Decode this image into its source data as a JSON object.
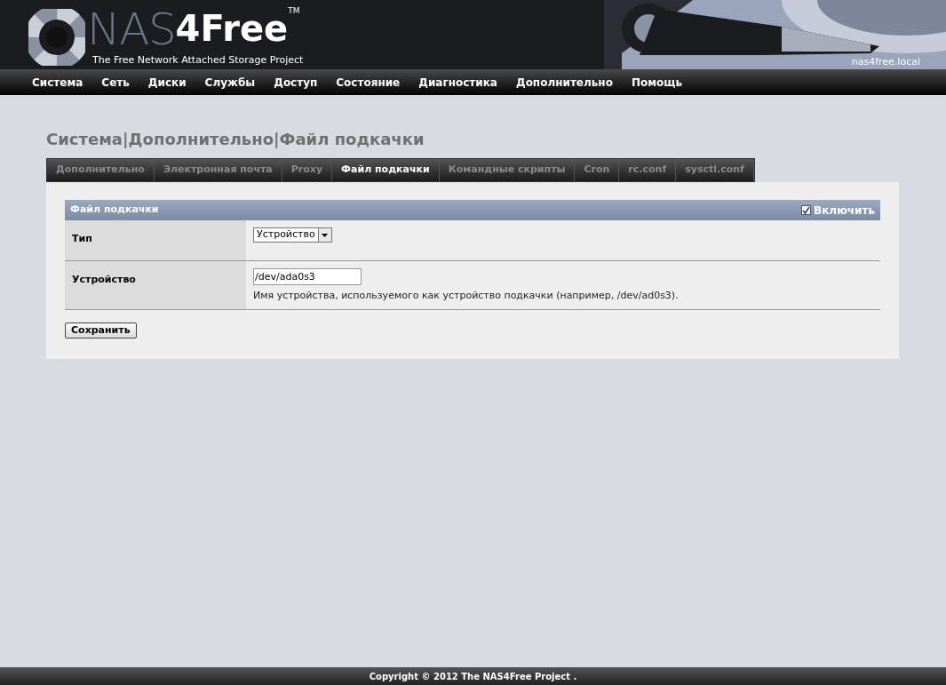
{
  "header": {
    "logo": {
      "part_1": "NAS",
      "part_2": "4Free",
      "trademark": "TM",
      "tagline": "The Free Network Attached Storage Project"
    },
    "hostname": "nas4free.local"
  },
  "nav": [
    "Система",
    "Сеть",
    "Диски",
    "Службы",
    "Доступ",
    "Состояние",
    "Диагностика",
    "Дополнительно",
    "Помощь"
  ],
  "page_title": "Система|Дополнительно|Файл подкачки",
  "tabs": [
    {
      "label": "Дополнительно",
      "selected": false
    },
    {
      "label": "Электронная почта",
      "selected": false
    },
    {
      "label": "Proxy",
      "selected": false
    },
    {
      "label": "Файл подкачки",
      "selected": true
    },
    {
      "label": "Командные скрипты",
      "selected": false
    },
    {
      "label": "Cron",
      "selected": false
    },
    {
      "label": "rc.conf",
      "selected": false
    },
    {
      "label": "sysctl.conf",
      "selected": false
    }
  ],
  "section": {
    "title": "Файл подкачки",
    "enable": {
      "label": "Включить",
      "checked": true
    }
  },
  "rows": [
    {
      "kind": "select",
      "label": "Тип",
      "value": "Устройство"
    },
    {
      "kind": "input",
      "label": "Устройство",
      "value": "/dev/ada0s3",
      "hint": "Имя устройства, используемого как устройство подкачки (например, /dev/ad0s3)."
    }
  ],
  "save_button": "Сохранить",
  "footer": "Copyright © 2012 The NAS4Free Project ."
}
